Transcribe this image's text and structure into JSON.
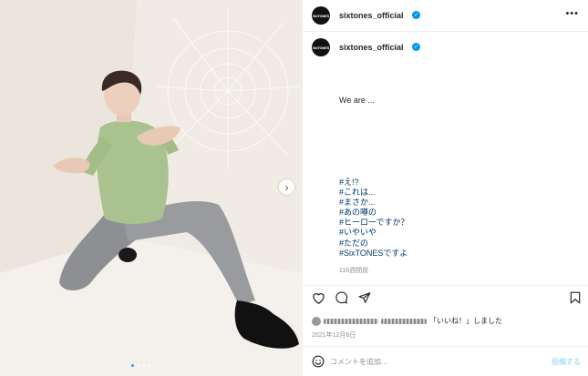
{
  "header": {
    "avatar_text": "SixTONES",
    "username": "sixtones_official",
    "more_icon": "more-options-icon"
  },
  "post_author": {
    "avatar_text": "SixTONES",
    "username": "sixtones_official"
  },
  "caption": {
    "intro": "We are ...",
    "hashtags": [
      "#え!?",
      "#これは...",
      "#まさか...",
      "#あの噂の",
      "#ヒーローですか？",
      "#いやいや",
      "#ただの",
      "#SixTONESですよ"
    ]
  },
  "time_ago": "116週間前",
  "likes": {
    "suffix": "「いいね！」しました"
  },
  "date": "2021年12月6日",
  "comment": {
    "placeholder": "コメントを追加...",
    "post_label": "投稿する"
  },
  "carousel": {
    "dots": 5,
    "active_index": 0,
    "next_icon": "chevron-right-icon"
  },
  "colors": {
    "link": "#00376b",
    "verified": "#0095f6",
    "muted": "#8e8e8e"
  }
}
